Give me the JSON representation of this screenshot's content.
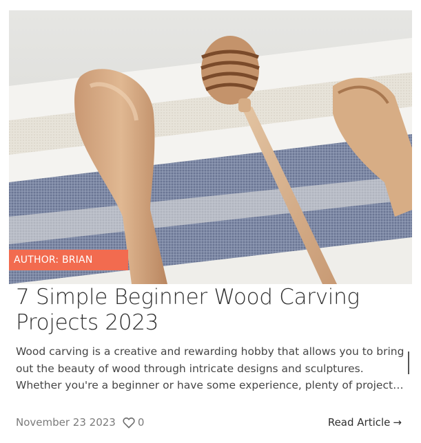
{
  "article": {
    "author_label": "AUTHOR: BRIAN",
    "title": "7 Simple Beginner Wood Carving Projects 2023",
    "excerpt": "Wood carving is a creative and rewarding hobby that allows you to bring out the beauty of wood through intricate designs and sculptures. Whether you're a beginner or have some experience, plenty of projects can help you hone your skills.",
    "date": "November 23 2023",
    "likes": "0",
    "read_more": "Read Article",
    "read_more_arrow": "→"
  },
  "icons": {
    "like": "heart-outline-icon"
  },
  "colors": {
    "badge": "#f26b4f",
    "title": "#2f2f2f",
    "meta": "#7a7a7a"
  }
}
